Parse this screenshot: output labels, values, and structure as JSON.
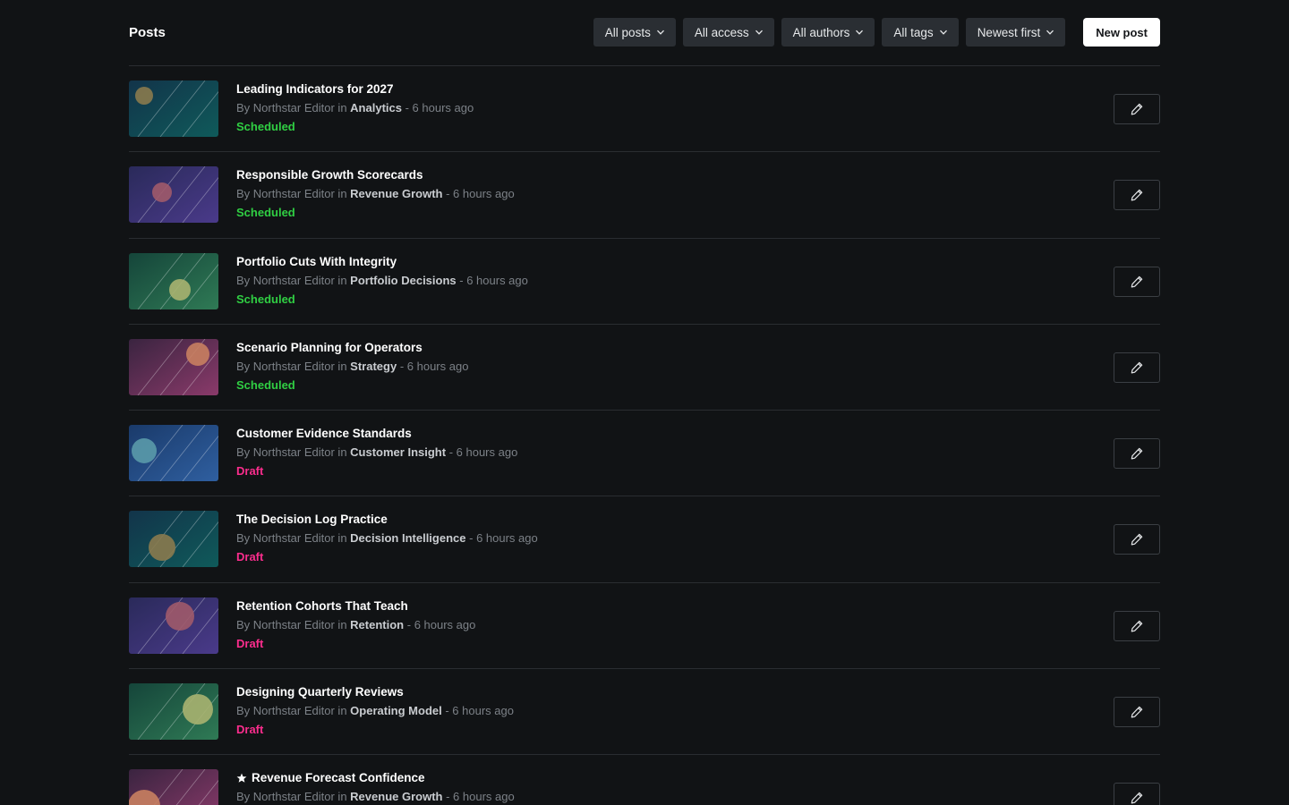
{
  "header": {
    "title": "Posts",
    "filters": [
      "All posts",
      "All access",
      "All authors",
      "All tags",
      "Newest first"
    ],
    "new_post_label": "New post"
  },
  "colors": {
    "scheduled": "#30cf43",
    "draft": "#fb2d8d"
  },
  "posts": [
    {
      "title": "Leading Indicators for 2027",
      "by": "By Northstar Editor in",
      "category": "Analytics",
      "time": "- 6 hours ago",
      "status": "Scheduled",
      "featured": false,
      "theme": "teal"
    },
    {
      "title": "Responsible Growth Scorecards",
      "by": "By Northstar Editor in",
      "category": "Revenue Growth",
      "time": "- 6 hours ago",
      "status": "Scheduled",
      "featured": false,
      "theme": "indigo"
    },
    {
      "title": "Portfolio Cuts With Integrity",
      "by": "By Northstar Editor in",
      "category": "Portfolio Decisions",
      "time": "- 6 hours ago",
      "status": "Scheduled",
      "featured": false,
      "theme": "green"
    },
    {
      "title": "Scenario Planning for Operators",
      "by": "By Northstar Editor in",
      "category": "Strategy",
      "time": "- 6 hours ago",
      "status": "Scheduled",
      "featured": false,
      "theme": "plum"
    },
    {
      "title": "Customer Evidence Standards",
      "by": "By Northstar Editor in",
      "category": "Customer Insight",
      "time": "- 6 hours ago",
      "status": "Draft",
      "featured": false,
      "theme": "blue"
    },
    {
      "title": "The Decision Log Practice",
      "by": "By Northstar Editor in",
      "category": "Decision Intelligence",
      "time": "- 6 hours ago",
      "status": "Draft",
      "featured": false,
      "theme": "teal"
    },
    {
      "title": "Retention Cohorts That Teach",
      "by": "By Northstar Editor in",
      "category": "Retention",
      "time": "- 6 hours ago",
      "status": "Draft",
      "featured": false,
      "theme": "indigo"
    },
    {
      "title": "Designing Quarterly Reviews",
      "by": "By Northstar Editor in",
      "category": "Operating Model",
      "time": "- 6 hours ago",
      "status": "Draft",
      "featured": false,
      "theme": "green"
    },
    {
      "title": "Revenue Forecast Confidence",
      "by": "By Northstar Editor in",
      "category": "Revenue Growth",
      "time": "- 6 hours ago",
      "status": "",
      "featured": true,
      "theme": "plum"
    }
  ]
}
